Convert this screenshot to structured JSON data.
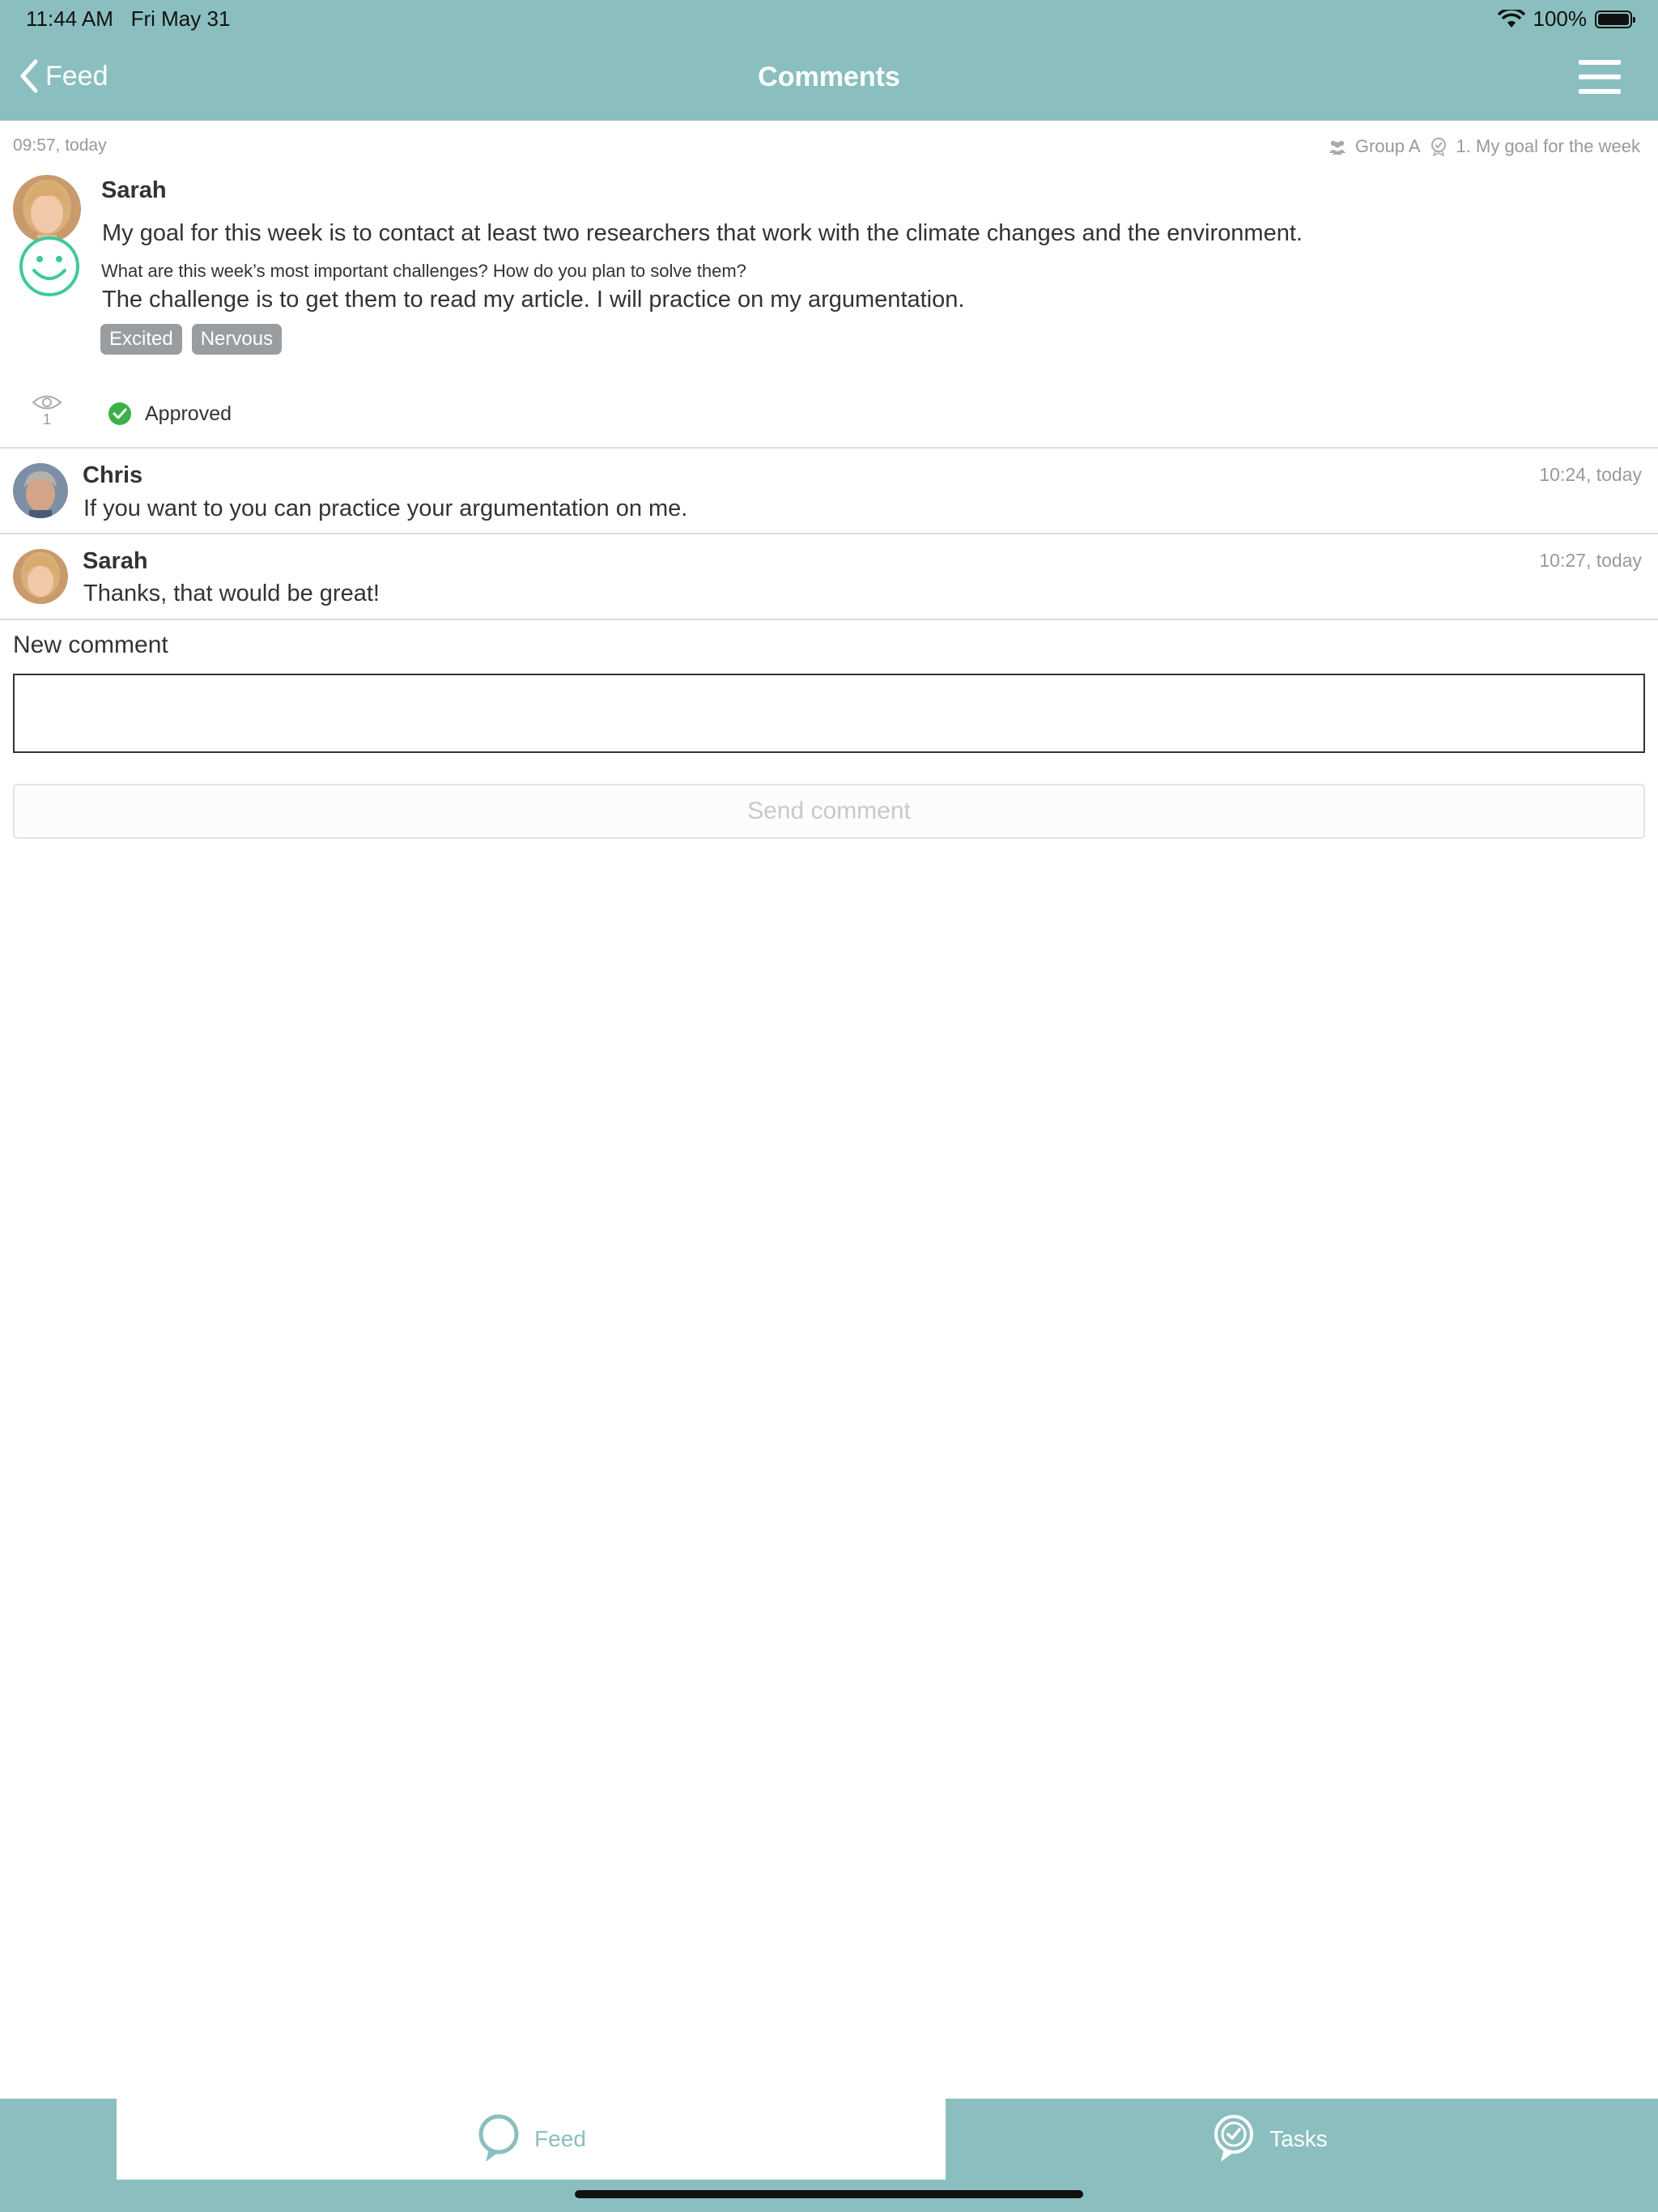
{
  "status_bar": {
    "time": "11:44 AM",
    "date": "Fri May 31",
    "battery": "100%"
  },
  "nav": {
    "back_label": "Feed",
    "title": "Comments"
  },
  "post": {
    "time": "09:57, today",
    "group": "Group A",
    "goal_ref": "1. My goal for the week",
    "author": "Sarah",
    "goal_text": "My goal for this week is to contact at least two researchers that work with the climate changes and the environment.",
    "question": "What are this week’s most important challenges? How do you plan to solve them?",
    "answer": "The challenge is to get them to read my article. I will practice on my argumentation.",
    "tags": [
      "Excited",
      "Nervous"
    ],
    "views": "1",
    "status": "Approved",
    "mood_color": "#3fc99a",
    "approved_color": "#3cb14a"
  },
  "comments": [
    {
      "author": "Chris",
      "time": "10:24, today",
      "text": "If you want to you can practice your argumentation on me."
    },
    {
      "author": "Sarah",
      "time": "10:27, today",
      "text": "Thanks, that would be great!"
    }
  ],
  "new_comment": {
    "label": "New comment",
    "placeholder": "",
    "value": "",
    "send_label": "Send comment"
  },
  "tabs": {
    "feed": "Feed",
    "tasks": "Tasks"
  },
  "colors": {
    "accent": "#8bbfbf"
  }
}
